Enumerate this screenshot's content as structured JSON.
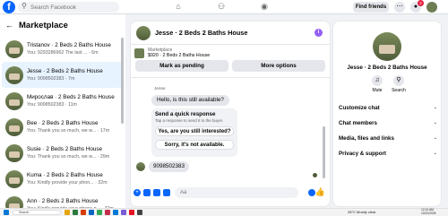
{
  "topbar": {
    "search_placeholder": "Search Facebook",
    "find_friends": "Find friends",
    "notification_count": "2"
  },
  "left": {
    "title": "Marketplace",
    "conversations": [
      {
        "name": "Tristanov · 2 Beds 2 Baths House",
        "preview": "You: 9293286962 The last ... · 6m",
        "unread": false
      },
      {
        "name": "Jesse · 2 Beds 2 Baths House",
        "preview": "You: 9098502383 · 7m",
        "unread": false
      },
      {
        "name": "Мирослав · 2 Beds 2 Baths House",
        "preview": "You: 9098502383 · 11m",
        "unread": false
      },
      {
        "name": "Bee · 2 Beds 2 Baths House",
        "preview": "You: Thank you so much, we w... · 17m",
        "unread": false
      },
      {
        "name": "Susie · 2 Beds 2 Baths House",
        "preview": "You: Thank you so much, we w... · 29m",
        "unread": false
      },
      {
        "name": "Kuma · 2 Beds 2 Baths House",
        "preview": "You: Kindly provide your phon... · 32m",
        "unread": false
      },
      {
        "name": "Ann · 2 Beds 2 Baths House",
        "preview": "You: Kindly provide your phone n... · 32m",
        "unread": false
      }
    ]
  },
  "chat": {
    "name": "Jesse · 2 Beds 2 Baths House",
    "listing_category": "Marketplace",
    "listing_desc": "$920 · 2 Beds 2 Baths House",
    "mark_pending": "Mark as pending",
    "more_options": "More options",
    "sender": "Jesse",
    "incoming_message": "Hello, is this still available?",
    "quick_title": "Send a quick response",
    "quick_sub": "Tap a response to send it to the buyer.",
    "quick_replies": [
      "Yes, are you still interested?",
      "Sorry, it's not available."
    ],
    "my_reply": "9098502383",
    "composer_placeholder": "Aa"
  },
  "right": {
    "name": "Jesse · 2 Beds 2 Baths House",
    "actions": [
      {
        "label": "Mute",
        "icon": "bell-icon"
      },
      {
        "label": "Search",
        "icon": "search-icon"
      }
    ],
    "sections": [
      "Customize chat",
      "Chat members",
      "Media, files and links",
      "Privacy & support"
    ]
  },
  "taskbar": {
    "search": "Search",
    "weather": "28°C  Mostly clear",
    "time": "12:14 AM",
    "date": "10/21/2025"
  }
}
